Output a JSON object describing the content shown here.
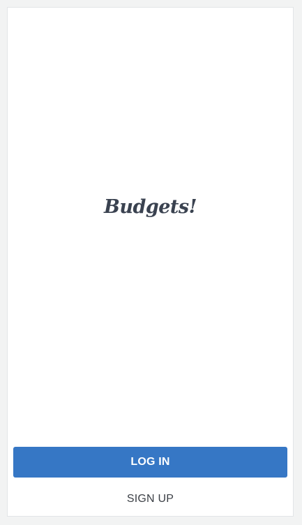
{
  "app": {
    "logo_text": "Budgets!"
  },
  "actions": {
    "login_label": "LOG IN",
    "signup_label": "SIGN UP"
  },
  "colors": {
    "primary": "#3677c5",
    "logo": "#3a4250",
    "background": "#f2f3f3"
  }
}
